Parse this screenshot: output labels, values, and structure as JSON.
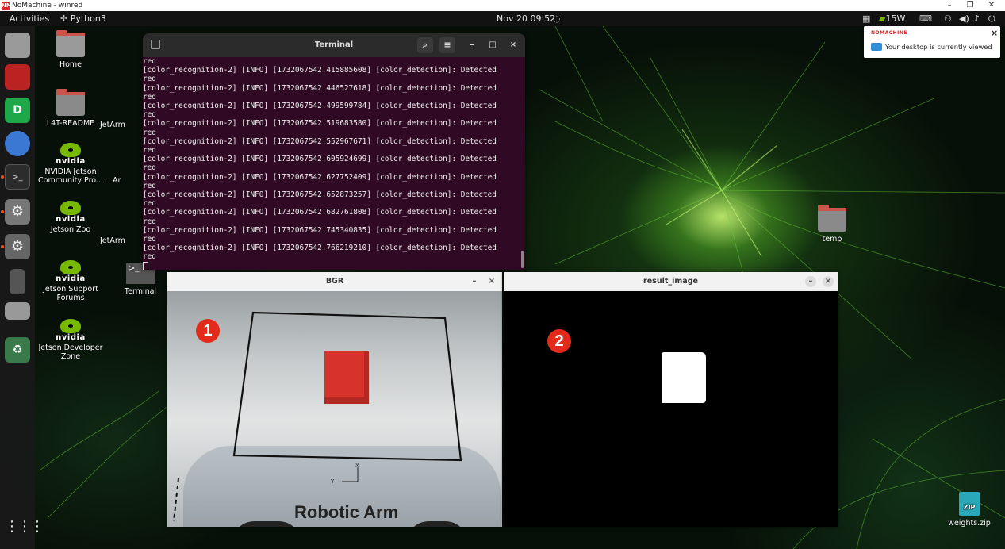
{
  "nomachine": {
    "title": "NoMachine - winred",
    "logo_text": "NM",
    "minimize": "–",
    "maximize": "❐",
    "close": "✕"
  },
  "panel": {
    "activities": "Activities",
    "app": "Python3",
    "clock": "Nov 20  09:52",
    "power": "15W"
  },
  "desktop_icons": {
    "home": "Home",
    "l4t": "L4T-README",
    "nvidia_brand": "nvidia",
    "jetson_community": "NVIDIA Jetson Community Pro...",
    "jetson_zoo": "Jetson Zoo",
    "jetson_support": "Jetson Support Forums",
    "jetson_dev": "Jetson Developer Zone",
    "jetarm1": "JetArm",
    "jetarm2": "JetArm",
    "ar": "Ar",
    "terminal": "Terminal",
    "temp": "temp",
    "weights": "weights.zip",
    "zip_badge": "ZIP"
  },
  "terminal": {
    "title": "Terminal",
    "prompt_char": "_",
    "lines": [
      "red",
      "[color_recognition-2] [INFO] [1732067542.415885608] [color_detection]: Detected",
      "red",
      "[color_recognition-2] [INFO] [1732067542.446527618] [color_detection]: Detected",
      "red",
      "[color_recognition-2] [INFO] [1732067542.499599784] [color_detection]: Detected",
      "red",
      "[color_recognition-2] [INFO] [1732067542.519683580] [color_detection]: Detected",
      "red",
      "[color_recognition-2] [INFO] [1732067542.552967671] [color_detection]: Detected",
      "red",
      "[color_recognition-2] [INFO] [1732067542.605924699] [color_detection]: Detected",
      "red",
      "[color_recognition-2] [INFO] [1732067542.627752409] [color_detection]: Detected",
      "red",
      "[color_recognition-2] [INFO] [1732067542.652873257] [color_detection]: Detected",
      "red",
      "[color_recognition-2] [INFO] [1732067542.682761808] [color_detection]: Detected",
      "red",
      "[color_recognition-2] [INFO] [1732067542.745340835] [color_detection]: Detected",
      "red",
      "[color_recognition-2] [INFO] [1732067542.766219210] [color_detection]: Detected",
      "red"
    ]
  },
  "bgr_window": {
    "title": "BGR",
    "badge": "1",
    "mat_text": "Robotic Arm",
    "axis_x": "X",
    "axis_y": "Y"
  },
  "result_window": {
    "title": "result_image",
    "badge": "2"
  },
  "notification": {
    "brand": "NOMACHINE",
    "message": "Your desktop is currently viewed",
    "close": "×"
  },
  "colors": {
    "terminal_bg": "#300a24",
    "accent_orange": "#e95420",
    "badge_red": "#e32b1b",
    "nvidia_green": "#76b900",
    "cube_red": "#d8332a"
  }
}
